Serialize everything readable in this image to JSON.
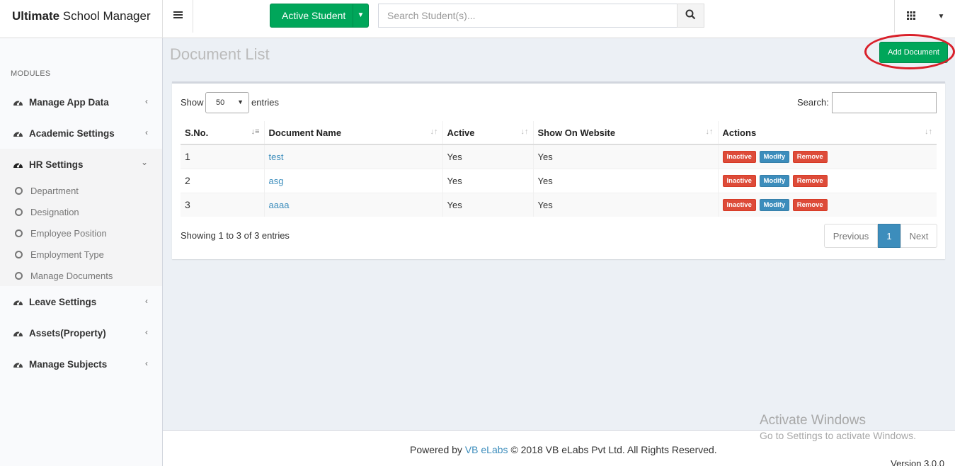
{
  "header": {
    "brand_bold": "Ultimate",
    "brand_rest": " School Manager",
    "toggle_icon": "hamburger-icon",
    "active_student_label": "Active Student",
    "search_placeholder": "Search Student(s)..."
  },
  "sidebar": {
    "section_label": "MODULES",
    "items": [
      {
        "label": "Manage App Data"
      },
      {
        "label": "Academic Settings"
      },
      {
        "label": "HR Settings"
      },
      {
        "label": "Leave Settings"
      },
      {
        "label": "Assets(Property)"
      },
      {
        "label": "Manage Subjects"
      }
    ],
    "hr_sub_items": [
      {
        "label": "Department"
      },
      {
        "label": "Designation"
      },
      {
        "label": "Employee Position"
      },
      {
        "label": "Employment Type"
      },
      {
        "label": "Manage Documents"
      }
    ]
  },
  "main": {
    "title": "Document List",
    "add_button": "Add Document",
    "show_label": "Show",
    "page_size": "50",
    "entries_label": "entries",
    "search_label": "Search:",
    "columns": [
      "S.No.",
      "Document Name",
      "Active",
      "Show On Website",
      "Actions"
    ],
    "rows": [
      {
        "sno": "1",
        "name": "test",
        "active": "Yes",
        "website": "Yes"
      },
      {
        "sno": "2",
        "name": "asg",
        "active": "Yes",
        "website": "Yes"
      },
      {
        "sno": "3",
        "name": "aaaa",
        "active": "Yes",
        "website": "Yes"
      }
    ],
    "actions": {
      "inactive": "Inactive",
      "modify": "Modify",
      "remove": "Remove"
    },
    "info": "Showing 1 to 3 of 3 entries",
    "pagination": {
      "previous": "Previous",
      "current": "1",
      "next": "Next"
    }
  },
  "footer": {
    "powered_by": "Powered by",
    "company_link": "VB eLabs",
    "copyright": "© 2018 VB eLabs Pvt Ltd. All Rights Reserved.",
    "version": "Version 3.0.0"
  },
  "watermark": {
    "title": "Activate Windows",
    "subtitle": "Go to Settings to activate Windows."
  },
  "colors": {
    "primary_green": "#00a65a",
    "link_blue": "#3c8dbc",
    "danger_red": "#dd4b39",
    "highlight_circle": "#d9202a"
  }
}
